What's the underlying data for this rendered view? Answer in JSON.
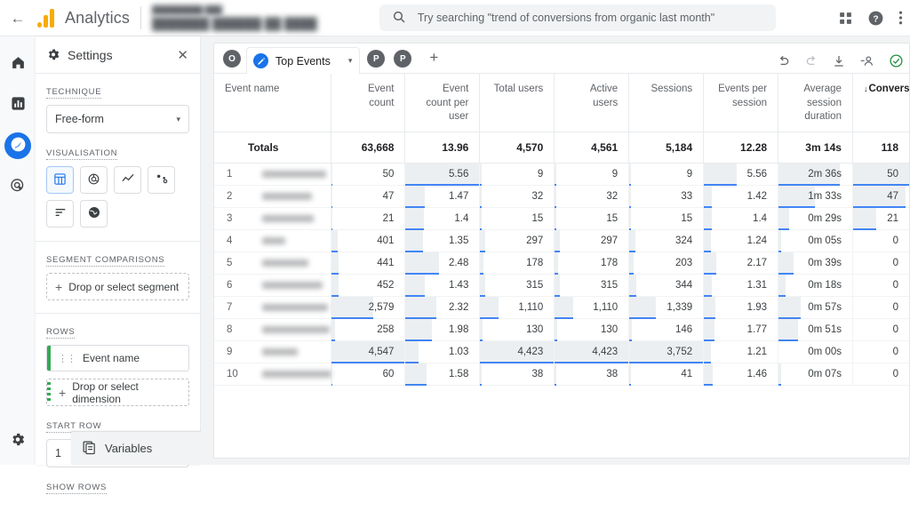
{
  "topbar": {
    "back_icon": "arrow-left-icon",
    "brand": "Analytics",
    "property_sub": "█████████ ███",
    "property_name": "███████ ██████ ██ ████",
    "search_placeholder": "Try searching \"trend of conversions from organic last month\"",
    "search_value": "",
    "icons": [
      "apps-grid-icon",
      "help-icon",
      "more-vert-icon"
    ]
  },
  "rail": {
    "items": [
      {
        "name": "home-icon",
        "label": "Home",
        "active": false
      },
      {
        "name": "reports-icon",
        "label": "Reports",
        "active": false
      },
      {
        "name": "explore-icon",
        "label": "Explore",
        "active": true
      },
      {
        "name": "advertising-icon",
        "label": "Advertising",
        "active": false
      }
    ],
    "bottom": {
      "name": "settings-gear-icon",
      "label": "Admin"
    }
  },
  "settings_panel": {
    "title": "Settings",
    "close_label": "✕",
    "technique": {
      "label": "TECHNIQUE",
      "value": "Free-form"
    },
    "visualisation": {
      "label": "VISUALISATION",
      "options": [
        {
          "icon": "table-chart-icon",
          "label": "Free-form table",
          "active": true
        },
        {
          "icon": "donut-chart-icon",
          "label": "Donut chart",
          "active": false
        },
        {
          "icon": "line-chart-icon",
          "label": "Line chart",
          "active": false
        },
        {
          "icon": "scatter-chart-icon",
          "label": "Scatter plot",
          "active": false
        },
        {
          "icon": "bar-chart-horizontal-icon",
          "label": "Bar chart",
          "active": false
        },
        {
          "icon": "geo-map-icon",
          "label": "Geo map",
          "active": false
        }
      ]
    },
    "segment_comparisons": {
      "label": "SEGMENT COMPARISONS",
      "drop_text": "Drop or select segment"
    },
    "rows": {
      "label": "ROWS",
      "chips": [
        "Event name"
      ],
      "drop_text": "Drop or select dimension"
    },
    "start_row": {
      "label": "START ROW",
      "value": "1"
    },
    "show_rows": {
      "label": "SHOW ROWS"
    },
    "variables_bar": {
      "label": "Variables",
      "icon": "variables-icon",
      "minimize": "—"
    }
  },
  "tabbar": {
    "left_avatar": "O",
    "active_tab": {
      "label": "Top Events",
      "icon": "pencil-icon",
      "caret": "▾"
    },
    "other_tabs": [
      "P",
      "P"
    ],
    "add_tab": "+",
    "tools": [
      {
        "icon": "undo-icon",
        "label": "Undo",
        "state": "enabled"
      },
      {
        "icon": "redo-icon",
        "label": "Redo",
        "state": "disabled"
      },
      {
        "icon": "download-icon",
        "label": "Download",
        "state": "enabled"
      },
      {
        "icon": "share-person-icon",
        "label": "Share",
        "state": "enabled"
      },
      {
        "icon": "check-circle-icon",
        "label": "Saved",
        "state": "ok"
      }
    ]
  },
  "table": {
    "columns": [
      {
        "label": "Event name",
        "align": "left",
        "sorted": false
      },
      {
        "label": "Event count",
        "align": "right",
        "sorted": false
      },
      {
        "label": "Event count per user",
        "align": "right",
        "sorted": false
      },
      {
        "label": "Total users",
        "align": "right",
        "sorted": false
      },
      {
        "label": "Active users",
        "align": "right",
        "sorted": false
      },
      {
        "label": "Sessions",
        "align": "right",
        "sorted": false
      },
      {
        "label": "Events per session",
        "align": "right",
        "sorted": false
      },
      {
        "label": "Average session duration",
        "align": "right",
        "sorted": false
      },
      {
        "label": "Conversions",
        "align": "right",
        "sorted": true,
        "sort_dir": "desc",
        "sort_arrow": "↓"
      }
    ],
    "totals_label": "Totals",
    "totals": [
      "63,668",
      "13.96",
      "4,570",
      "4,561",
      "5,184",
      "12.28",
      "3m 14s",
      "118"
    ],
    "rows": [
      {
        "index": "1",
        "name_redacted": true,
        "name_width": 72,
        "values": [
          "50",
          "5.56",
          "9",
          "9",
          "9",
          "5.56",
          "2m 36s",
          "50"
        ]
      },
      {
        "index": "2",
        "name_redacted": true,
        "name_width": 56,
        "values": [
          "47",
          "1.47",
          "32",
          "32",
          "33",
          "1.42",
          "1m 33s",
          "47"
        ]
      },
      {
        "index": "3",
        "name_redacted": true,
        "name_width": 58,
        "values": [
          "21",
          "1.4",
          "15",
          "15",
          "15",
          "1.4",
          "0m 29s",
          "21"
        ]
      },
      {
        "index": "4",
        "name_redacted": true,
        "name_width": 26,
        "values": [
          "401",
          "1.35",
          "297",
          "297",
          "324",
          "1.24",
          "0m 05s",
          "0"
        ]
      },
      {
        "index": "5",
        "name_redacted": true,
        "name_width": 52,
        "values": [
          "441",
          "2.48",
          "178",
          "178",
          "203",
          "2.17",
          "0m 39s",
          "0"
        ]
      },
      {
        "index": "6",
        "name_redacted": true,
        "name_width": 68,
        "values": [
          "452",
          "1.43",
          "315",
          "315",
          "344",
          "1.31",
          "0m 18s",
          "0"
        ]
      },
      {
        "index": "7",
        "name_redacted": true,
        "name_width": 74,
        "values": [
          "2,579",
          "2.32",
          "1,110",
          "1,110",
          "1,339",
          "1.93",
          "0m 57s",
          "0"
        ]
      },
      {
        "index": "8",
        "name_redacted": true,
        "name_width": 76,
        "values": [
          "258",
          "1.98",
          "130",
          "130",
          "146",
          "1.77",
          "0m 51s",
          "0"
        ]
      },
      {
        "index": "9",
        "name_redacted": true,
        "name_width": 40,
        "values": [
          "4,547",
          "1.03",
          "4,423",
          "4,423",
          "3,752",
          "1.21",
          "0m 00s",
          "0"
        ]
      },
      {
        "index": "10",
        "name_redacted": true,
        "name_width": 78,
        "values": [
          "60",
          "1.58",
          "38",
          "38",
          "41",
          "1.46",
          "0m 07s",
          "0"
        ]
      }
    ],
    "bar_percents": [
      [
        1.1,
        100,
        0.2,
        0.2,
        0.2,
        45,
        83,
        100
      ],
      [
        1.0,
        26,
        0.7,
        0.7,
        0.9,
        11,
        49,
        94
      ],
      [
        0.5,
        25,
        0.3,
        0.3,
        0.4,
        11,
        15,
        42
      ],
      [
        8.8,
        24,
        6.7,
        6.7,
        8.6,
        10,
        3,
        0
      ],
      [
        9.7,
        45,
        4.0,
        4.0,
        5.4,
        17,
        21,
        0
      ],
      [
        9.9,
        26,
        7.1,
        7.1,
        9.2,
        11,
        10,
        0
      ],
      [
        56.7,
        42,
        25.1,
        25.1,
        35.7,
        15,
        30,
        0
      ],
      [
        5.7,
        36,
        2.9,
        2.9,
        3.9,
        14,
        27,
        0
      ],
      [
        100,
        18,
        100,
        100,
        100,
        10,
        0,
        0
      ],
      [
        1.3,
        28,
        0.9,
        0.9,
        1.1,
        12,
        4,
        0
      ]
    ],
    "bar_color": "#eceff1",
    "bar_underline_color": "#4285f4"
  }
}
